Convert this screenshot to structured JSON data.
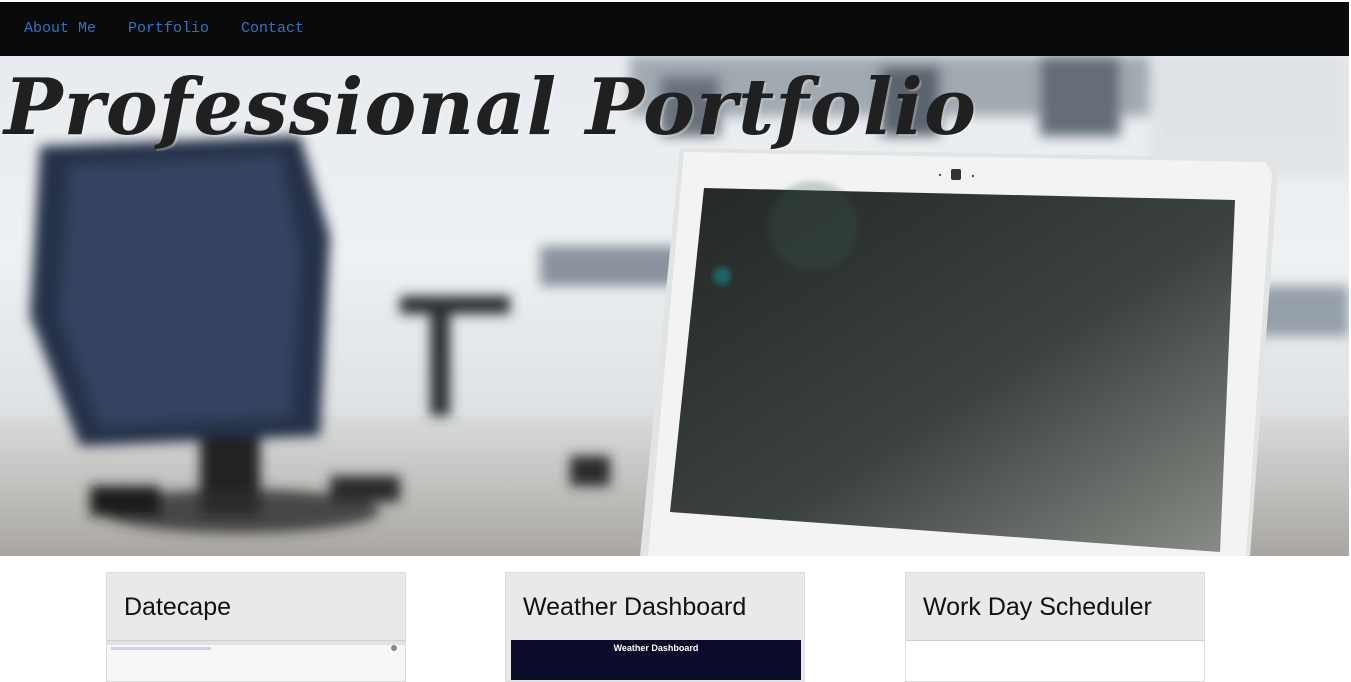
{
  "nav": {
    "items": [
      {
        "label": "About Me"
      },
      {
        "label": "Portfolio"
      },
      {
        "label": "Contact"
      }
    ],
    "link_color": "#2f73c8",
    "background": "#0a0a0a"
  },
  "hero": {
    "title": "Professional Portfolio",
    "image_icon": "office-laptop-hero-image"
  },
  "cards": [
    {
      "title": "Datecape",
      "thumbnail_icon": "browser-screenshot-thumbnail"
    },
    {
      "title": "Weather Dashboard",
      "thumbnail_text": "Weather Dashboard",
      "thumbnail_icon": "weather-dashboard-thumbnail"
    },
    {
      "title": "Work Day Scheduler",
      "thumbnail_icon": "scheduler-thumbnail"
    }
  ]
}
